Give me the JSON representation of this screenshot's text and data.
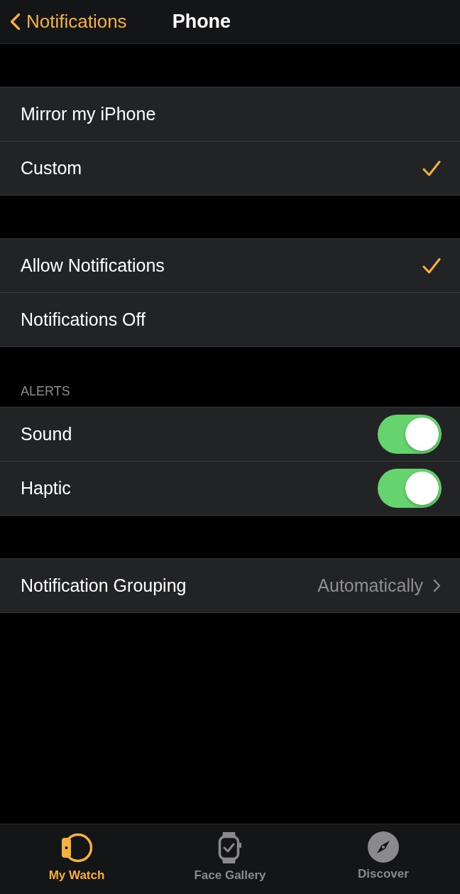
{
  "nav_bar": {
    "back_label": "Notifications",
    "title": "Phone"
  },
  "sections": [
    {
      "rows": [
        {
          "kind": "choice",
          "label": "Mirror my iPhone",
          "selected": false
        },
        {
          "kind": "choice",
          "label": "Custom",
          "selected": true
        }
      ]
    },
    {
      "rows": [
        {
          "kind": "choice",
          "label": "Allow Notifications",
          "selected": true
        },
        {
          "kind": "choice",
          "label": "Notifications Off",
          "selected": false
        }
      ]
    },
    {
      "header": "ALERTS",
      "rows": [
        {
          "kind": "toggle",
          "label": "Sound",
          "on": true
        },
        {
          "kind": "toggle",
          "label": "Haptic",
          "on": true
        }
      ]
    },
    {
      "rows": [
        {
          "kind": "disclosure",
          "label": "Notification Grouping",
          "value": "Automatically"
        }
      ]
    }
  ],
  "tab_bar": [
    {
      "label": "My Watch",
      "selected": true
    },
    {
      "label": "Face Gallery",
      "selected": false
    },
    {
      "label": "Discover",
      "selected": false
    }
  ]
}
